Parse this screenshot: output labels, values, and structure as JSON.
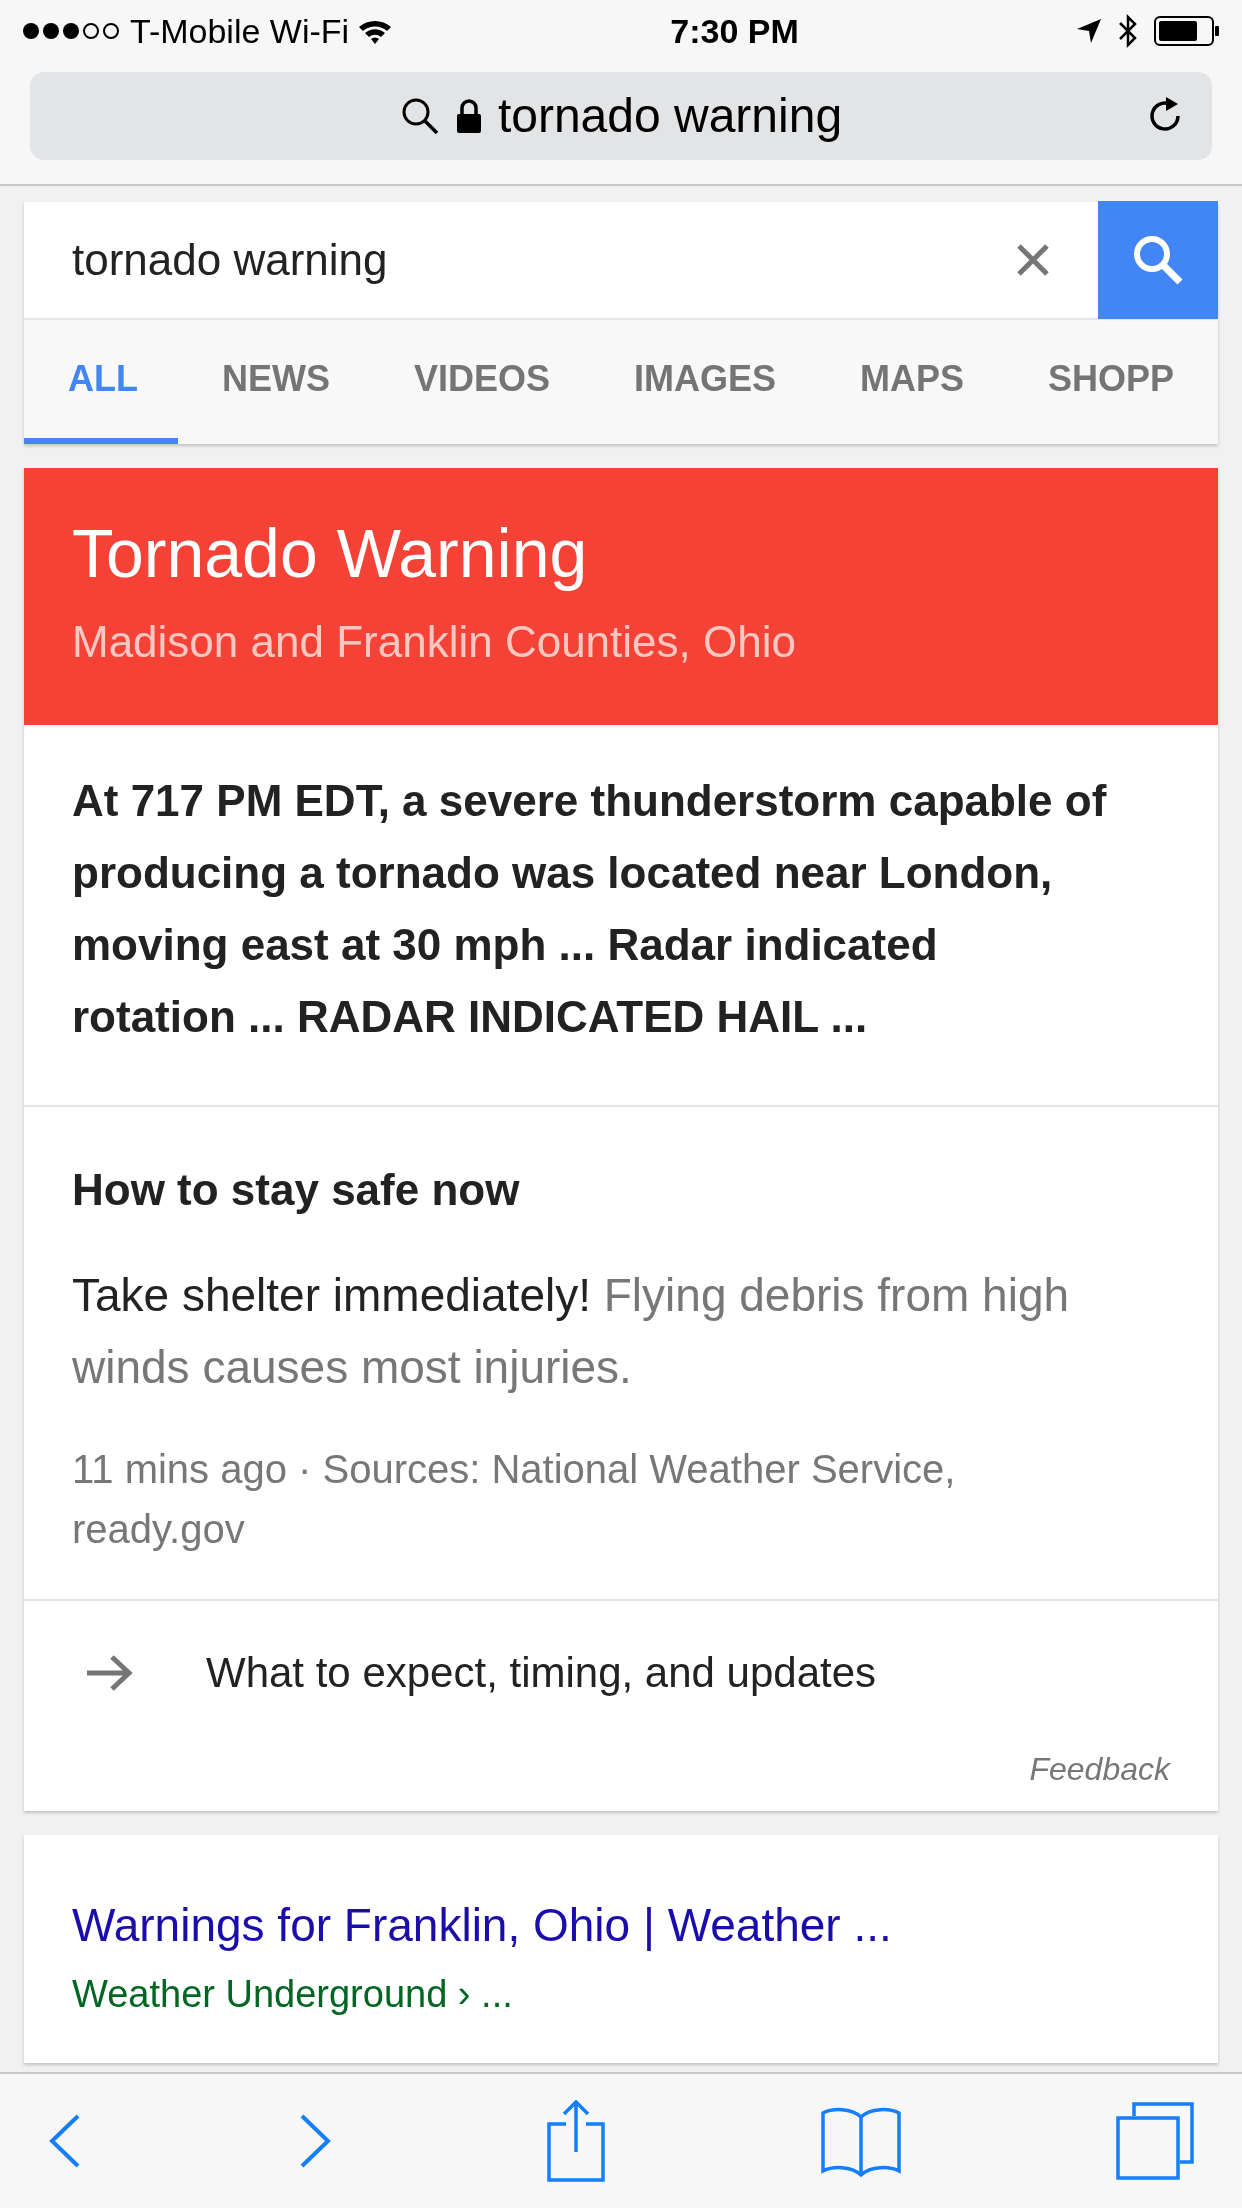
{
  "status_bar": {
    "carrier": "T-Mobile Wi-Fi",
    "time": "7:30 PM"
  },
  "address_bar": {
    "text": "tornado warning"
  },
  "search": {
    "value": "tornado warning"
  },
  "tabs": [
    {
      "label": "ALL",
      "selected": true
    },
    {
      "label": "NEWS",
      "selected": false
    },
    {
      "label": "VIDEOS",
      "selected": false
    },
    {
      "label": "IMAGES",
      "selected": false
    },
    {
      "label": "MAPS",
      "selected": false
    },
    {
      "label": "SHOPP",
      "selected": false
    }
  ],
  "alert": {
    "title": "Tornado Warning",
    "subtitle": "Madison and Franklin Counties, Ohio",
    "body": "At 717 PM EDT, a severe thunderstorm capable of producing a tornado was located near London, moving east at 30 mph ... Radar indicated rotation ... RADAR INDICATED HAIL ...",
    "safety_heading": "How to stay safe now",
    "safety_lead": "Take shelter immediately!",
    "safety_rest": "Flying debris from high winds causes most injuries.",
    "sources": "11 mins ago · Sources: National Weather Service, ready.gov",
    "link": "What to expect, timing, and updates",
    "feedback": "Feedback"
  },
  "result": {
    "title": "Warnings for Franklin, Ohio | Weather ...",
    "breadcrumb": "Weather Underground › ..."
  }
}
